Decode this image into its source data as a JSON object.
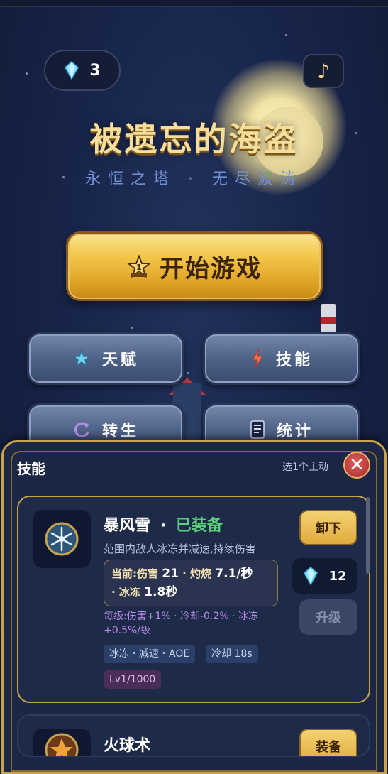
{
  "header": {
    "gem_count": "3",
    "gem_icon": "diamond-icon",
    "music_icon": "music-note-icon",
    "music_glyph": "♪"
  },
  "title": {
    "main": "被遗忘的海盗",
    "subtitle": "永恒之塔 · 无尽波涛"
  },
  "start_button": {
    "label": "开始游戏",
    "icon": "rank-star-icon"
  },
  "menu": [
    {
      "label": "天赋",
      "icon": "star-icon"
    },
    {
      "label": "技能",
      "icon": "lightning-icon"
    },
    {
      "label": "转生",
      "icon": "rebirth-icon"
    },
    {
      "label": "统计",
      "icon": "stats-icon"
    }
  ],
  "skills_panel": {
    "title": "技能",
    "hint": "选1个主动",
    "close_glyph": "✕",
    "skills": [
      {
        "name": "暴风雪",
        "separator": "·",
        "status": "已装备",
        "description": "范围内敌人冰冻并减速,持续伤害",
        "stats_line1_prefix": "当前:伤害",
        "stats_damage": "21",
        "stats_burn_label": "· 灼烧",
        "stats_burn": "7.1/秒",
        "stats_freeze_label": "· 冰冻",
        "stats_freeze": "1.8秒",
        "per_level": "每级:伤害+1% · 冷却-0.2% · 冰冻+0.5%/级",
        "tags": [
          "冰冻・减速・AOE",
          "冷却 18s"
        ],
        "level": "Lv1/1000",
        "action_label": "卸下",
        "upgrade_cost": "12",
        "upgrade_label": "升级"
      },
      {
        "name": "火球术",
        "action_label": "装备"
      }
    ]
  },
  "colors": {
    "gold": "#c9a24e",
    "equipped_green": "#5bd07a",
    "close_red": "#c0393a"
  }
}
